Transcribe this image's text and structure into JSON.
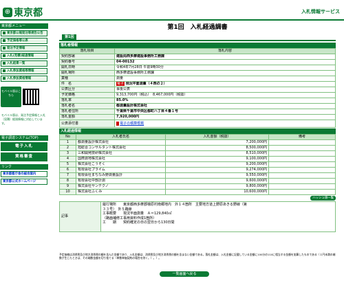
{
  "header": {
    "logo": "東京都",
    "service": "入札情報サービス"
  },
  "sidebar": {
    "menu_head": "東京都メニュー",
    "items": [
      "東京都公報発注等規告公告",
      "予定価格等公表",
      "発注予定情報",
      "入札(見積)経過情報",
      "入札結果一覧",
      "入札参加資格等情報",
      "入札参加資格情報"
    ],
    "mobile_btn": "モバイル版はこちら",
    "mobile_text": "モバイル版は、発注予定情報と入札（見積）経過情報に対応しています。",
    "big_head": "電子調達システム(TOP)",
    "big_items": [
      "電子入札",
      "資格審査"
    ],
    "link_head": "リンク",
    "links": [
      "東京都都庁舎の総合案内",
      "東京都公式ホームページ"
    ]
  },
  "title": "第1回　入札経過調書",
  "tab": "第1回",
  "info_section": "落札者情報",
  "info_header": [
    "落札項目",
    "落札内容"
  ],
  "info_rows": [
    [
      "契約部署",
      "建設局西多摩建設事務所工務課"
    ],
    [
      "契約番号",
      "04-00132"
    ],
    [
      "開札日時",
      "令和4年7月28日 午前9時30分"
    ],
    [
      "開札場所",
      "西多摩建設事務所工務課"
    ],
    [
      "業種",
      "測量"
    ],
    [
      "件　名",
      "電子",
      "現況平面測量（４西の２）"
    ],
    [
      "公表区分",
      "事後公表"
    ],
    [
      "予定価格",
      "9,313,700円（税込）　8,467,000円（税抜）"
    ],
    [
      "落札率",
      "85.0%"
    ],
    [
      "落札者名",
      "都測量設計株式会社"
    ],
    [
      "落札者住所",
      "千葉県千葉市中央区都町八丁目４番１号"
    ],
    [
      "落札金額",
      "7,920,000円"
    ],
    [
      "公表添付書",
      "電子の積算根拠"
    ]
  ],
  "bid_section": "入札経過情報",
  "bid_header": [
    "No",
    "入札者氏名",
    "入札金額（税抜）",
    "備考"
  ],
  "bids": [
    [
      "1",
      "都測量設計株式会社",
      "7,200,000円",
      ""
    ],
    [
      "2",
      "旭総合コンサルタント株式会社",
      "8,500,000円",
      ""
    ],
    [
      "3",
      "三和開発技研株式会社",
      "8,510,000円",
      ""
    ],
    [
      "4",
      "国際測地株式会社",
      "9,100,000円",
      ""
    ],
    [
      "5",
      "株式会社こうそく",
      "9,200,000円",
      ""
    ],
    [
      "6",
      "有限会社プライム",
      "9,274,000円",
      ""
    ],
    [
      "7",
      "有限会社まちなみ野測量設計",
      "9,550,000円",
      ""
    ],
    [
      "8",
      "有限会社中部計測",
      "9,600,000円",
      ""
    ],
    [
      "9",
      "株式会社サンテクノ",
      "9,800,000円",
      ""
    ],
    [
      "10",
      "株式会社ふくみ",
      "10,600,000円",
      ""
    ]
  ],
  "hash_btn": "ハッシュ値一覧",
  "remarks_label": "記事",
  "remarks": [
    "履行場所　　東京都西多摩郡檜原村南郷地内　外１４箇所　主要地方道上野原あきる野線（第",
    "３３号）　外５路線",
    "工事概要　　現況平面測量　Ａ＝129,840㎡",
    "（路面補修工事用資料作成1箇所）",
    "工　　期　　契約確定の日の翌日から130日間"
  ],
  "footnote": "予定価格は消費税及び地方消費税の額を含んだ金額であり、入札金額は、消費税及び地方消費税の額を含まない金額である。落札金額は、入札金額に記載している金額に100分の110に相当する金額を加算したものである（１円未満の端数が生じたときは、その端数金額を切り捨てる（単数単価契約の場合を除く。）。）。",
  "back_btn": "一覧画面へ戻る"
}
